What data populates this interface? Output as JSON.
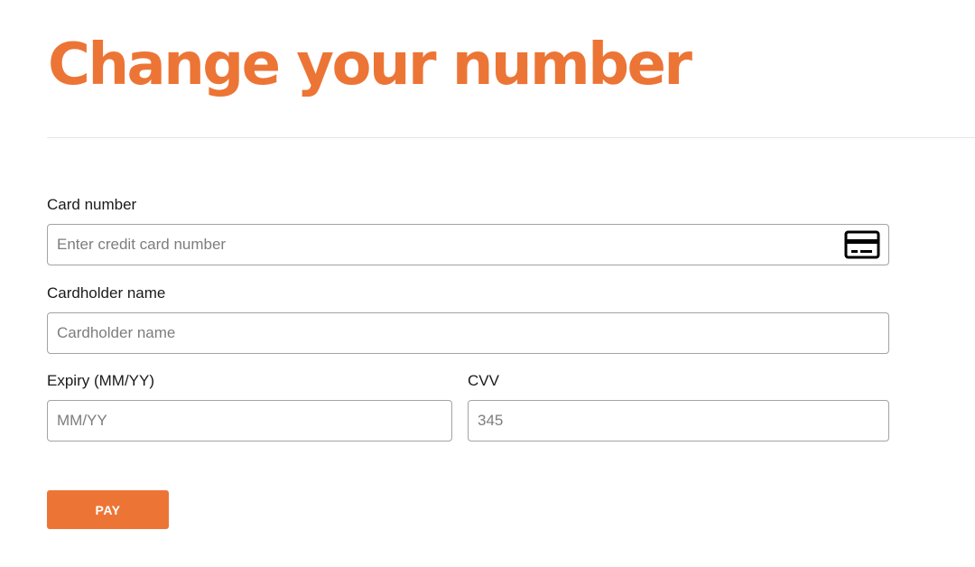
{
  "page": {
    "title": "Change your number"
  },
  "form": {
    "card_number": {
      "label": "Card number",
      "value": "",
      "placeholder": "Enter credit card number",
      "icon": "credit-card-icon"
    },
    "cardholder_name": {
      "label": "Cardholder name",
      "value": "",
      "placeholder": "Cardholder name"
    },
    "expiry": {
      "label": "Expiry (MM/YY)",
      "value": "",
      "placeholder": "MM/YY"
    },
    "cvv": {
      "label": "CVV",
      "value": "",
      "placeholder": "345"
    },
    "submit_label": "PAY"
  },
  "colors": {
    "accent": "#ec7536",
    "input_border": "#a3a3a3",
    "divider": "#e6e6e6",
    "placeholder": "#7d7d7d"
  }
}
